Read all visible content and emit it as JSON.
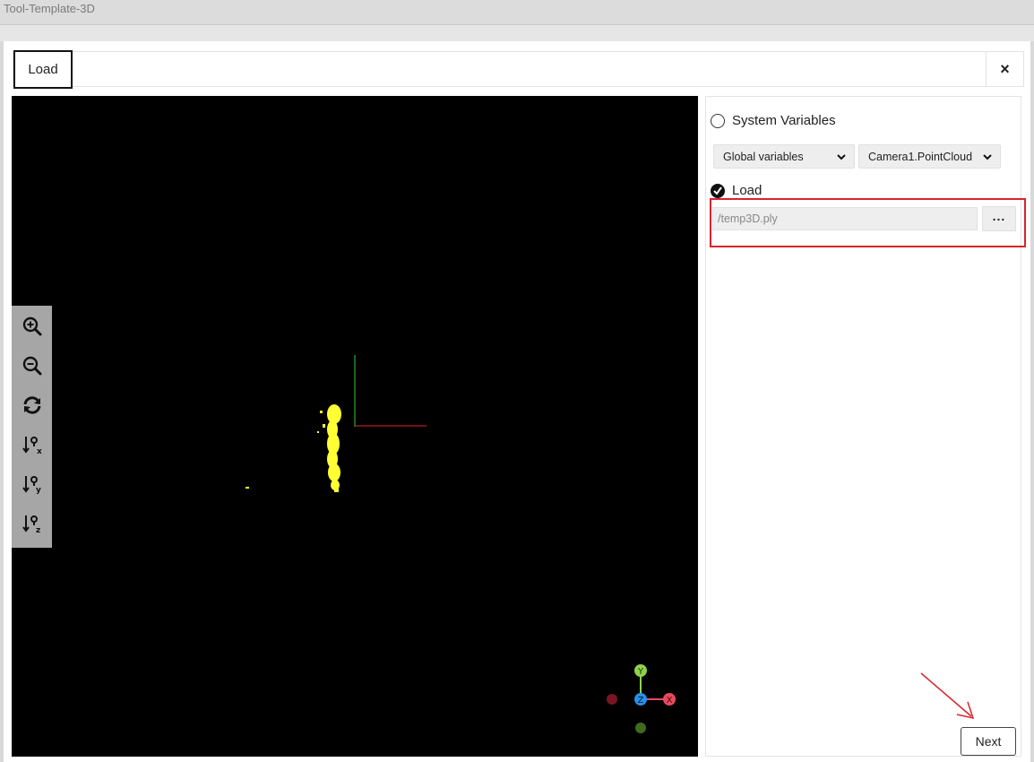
{
  "window": {
    "title": "Tool-Template-3D"
  },
  "tabs": [
    {
      "label": "Load",
      "active": true
    }
  ],
  "close_label": "×",
  "viewer": {
    "tools": [
      "zoom-in-icon",
      "zoom-out-icon",
      "reset-view-icon",
      "view-x-icon",
      "view-y-icon",
      "view-z-icon"
    ],
    "gizmo": {
      "y_label": "Y",
      "z_label": "Z",
      "x_label": "X"
    },
    "point_color": "#ffff33",
    "axis_colors": {
      "x": "#e8232e",
      "y": "#3cc83c",
      "z": "#2a8fe8"
    }
  },
  "panel": {
    "system_variables": {
      "label": "System Variables",
      "selected": false
    },
    "scope_select": {
      "value": "Global variables"
    },
    "variable_select": {
      "value": "Camera1.PointCloud"
    },
    "load": {
      "label": "Load",
      "selected": true
    },
    "path_input": {
      "value": "/temp3D.ply"
    },
    "browse_button": "..."
  },
  "next_label": "Next",
  "accent_color": "#d9232e"
}
